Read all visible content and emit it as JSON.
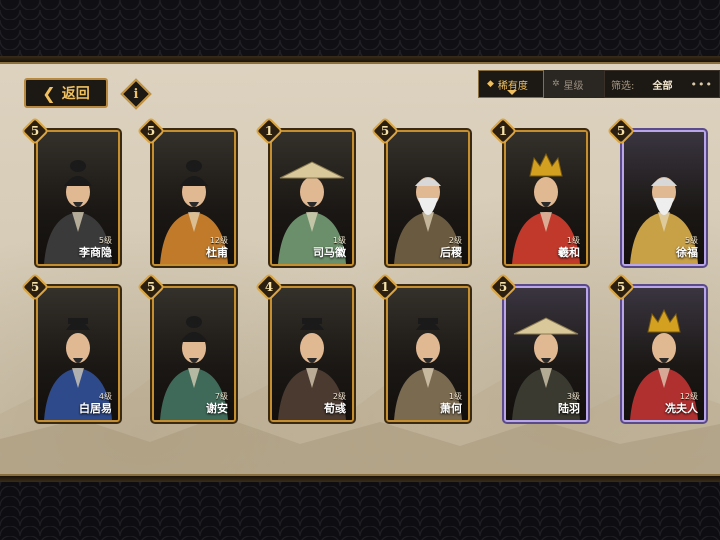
{
  "nav": {
    "back_label": "返回",
    "info_symbol": "i"
  },
  "sort": {
    "tabs": [
      {
        "symbol": "◆",
        "label": "稀有度",
        "active": true
      },
      {
        "symbol": "✲",
        "label": "星级",
        "active": false
      }
    ],
    "filter_label": "筛选:",
    "filter_value": "全部",
    "more_symbol": "•••"
  },
  "heroes": [
    {
      "stars": "5",
      "level": "5级",
      "name": "李商隐",
      "frame": "gold",
      "hat": "topknot",
      "robe": "#3a3a3a"
    },
    {
      "stars": "5",
      "level": "12级",
      "name": "杜甫",
      "frame": "gold",
      "hat": "topknot",
      "robe": "#c07a2a"
    },
    {
      "stars": "1",
      "level": "1级",
      "name": "司马徽",
      "frame": "gold",
      "hat": "straw",
      "robe": "#6a8f6a"
    },
    {
      "stars": "5",
      "level": "2级",
      "name": "后稷",
      "frame": "gold",
      "hat": "bald",
      "robe": "#6a5a40"
    },
    {
      "stars": "1",
      "level": "1级",
      "name": "羲和",
      "frame": "gold",
      "hat": "crown",
      "robe": "#c0392b"
    },
    {
      "stars": "5",
      "level": "5级",
      "name": "徐福",
      "frame": "purple",
      "hat": "bald",
      "robe": "#c8a046"
    },
    {
      "stars": "5",
      "level": "4级",
      "name": "白居易",
      "frame": "gold",
      "hat": "cap",
      "robe": "#2e4a8a"
    },
    {
      "stars": "5",
      "level": "7级",
      "name": "谢安",
      "frame": "gold",
      "hat": "topknot",
      "robe": "#3f6a5a"
    },
    {
      "stars": "4",
      "level": "2级",
      "name": "荀彧",
      "frame": "gold",
      "hat": "cap",
      "robe": "#4a3a30"
    },
    {
      "stars": "1",
      "level": "1级",
      "name": "萧何",
      "frame": "gold",
      "hat": "cap",
      "robe": "#7a6a50"
    },
    {
      "stars": "5",
      "level": "3级",
      "name": "陆羽",
      "frame": "purple",
      "hat": "straw",
      "robe": "#3a3a30"
    },
    {
      "stars": "5",
      "level": "12级",
      "name": "冼夫人",
      "frame": "purple",
      "hat": "crown",
      "robe": "#b03030"
    }
  ]
}
